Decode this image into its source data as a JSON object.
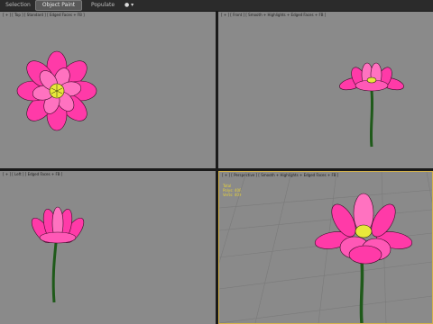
{
  "toolbar": {
    "tabs": [
      {
        "label": "Selection"
      },
      {
        "label": "Object Paint"
      },
      {
        "label": "Populate"
      }
    ],
    "extra_icon": "eye-dropdown-icon"
  },
  "viewports": {
    "top_left": {
      "label": "[ + ] [ Top ] [ Standard ] [ Edged Faces + FB ]"
    },
    "top_right": {
      "label": "[ + ] [ Front ] [ Smooth + Highlights + Edged Faces + FB ]"
    },
    "bottom_left": {
      "label": "[ + ] [ Left ] [ Edged Faces + FB ]"
    },
    "bottom_right": {
      "label": "[ + ] [ Perspective ] [ Smooth + Highlights + Edged Faces + FB ]"
    },
    "stats": [
      "Total",
      "Polys: 408",
      "Verts: 409"
    ]
  },
  "colors": {
    "petal": "#ff3aa8",
    "petal_light": "#ffb0de",
    "center": "#e8e83a",
    "stem": "#1f5a1a",
    "viewport_bg": "#8a8a8a",
    "active_border": "#d4b24a"
  }
}
